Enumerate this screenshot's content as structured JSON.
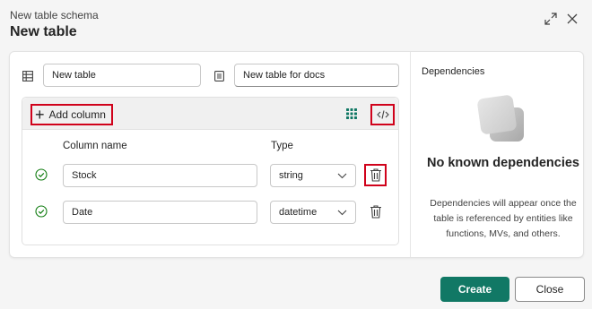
{
  "header": {
    "subtitle": "New table schema",
    "title": "New table"
  },
  "form": {
    "table_name": "New table",
    "table_doc": "New table for docs"
  },
  "toolbar": {
    "add_column_label": "Add column"
  },
  "columns": {
    "name_header": "Column name",
    "type_header": "Type",
    "rows": [
      {
        "name": "Stock",
        "type": "string"
      },
      {
        "name": "Date",
        "type": "datetime"
      }
    ]
  },
  "dependencies": {
    "title": "Dependencies",
    "empty_title": "No known dependencies",
    "description": "Dependencies will appear once the table is referenced by entities like functions, MVs, and others."
  },
  "footer": {
    "create_label": "Create",
    "close_label": "Close"
  },
  "colors": {
    "primary": "#117865",
    "highlight": "#d0021b",
    "success": "#107c10"
  }
}
